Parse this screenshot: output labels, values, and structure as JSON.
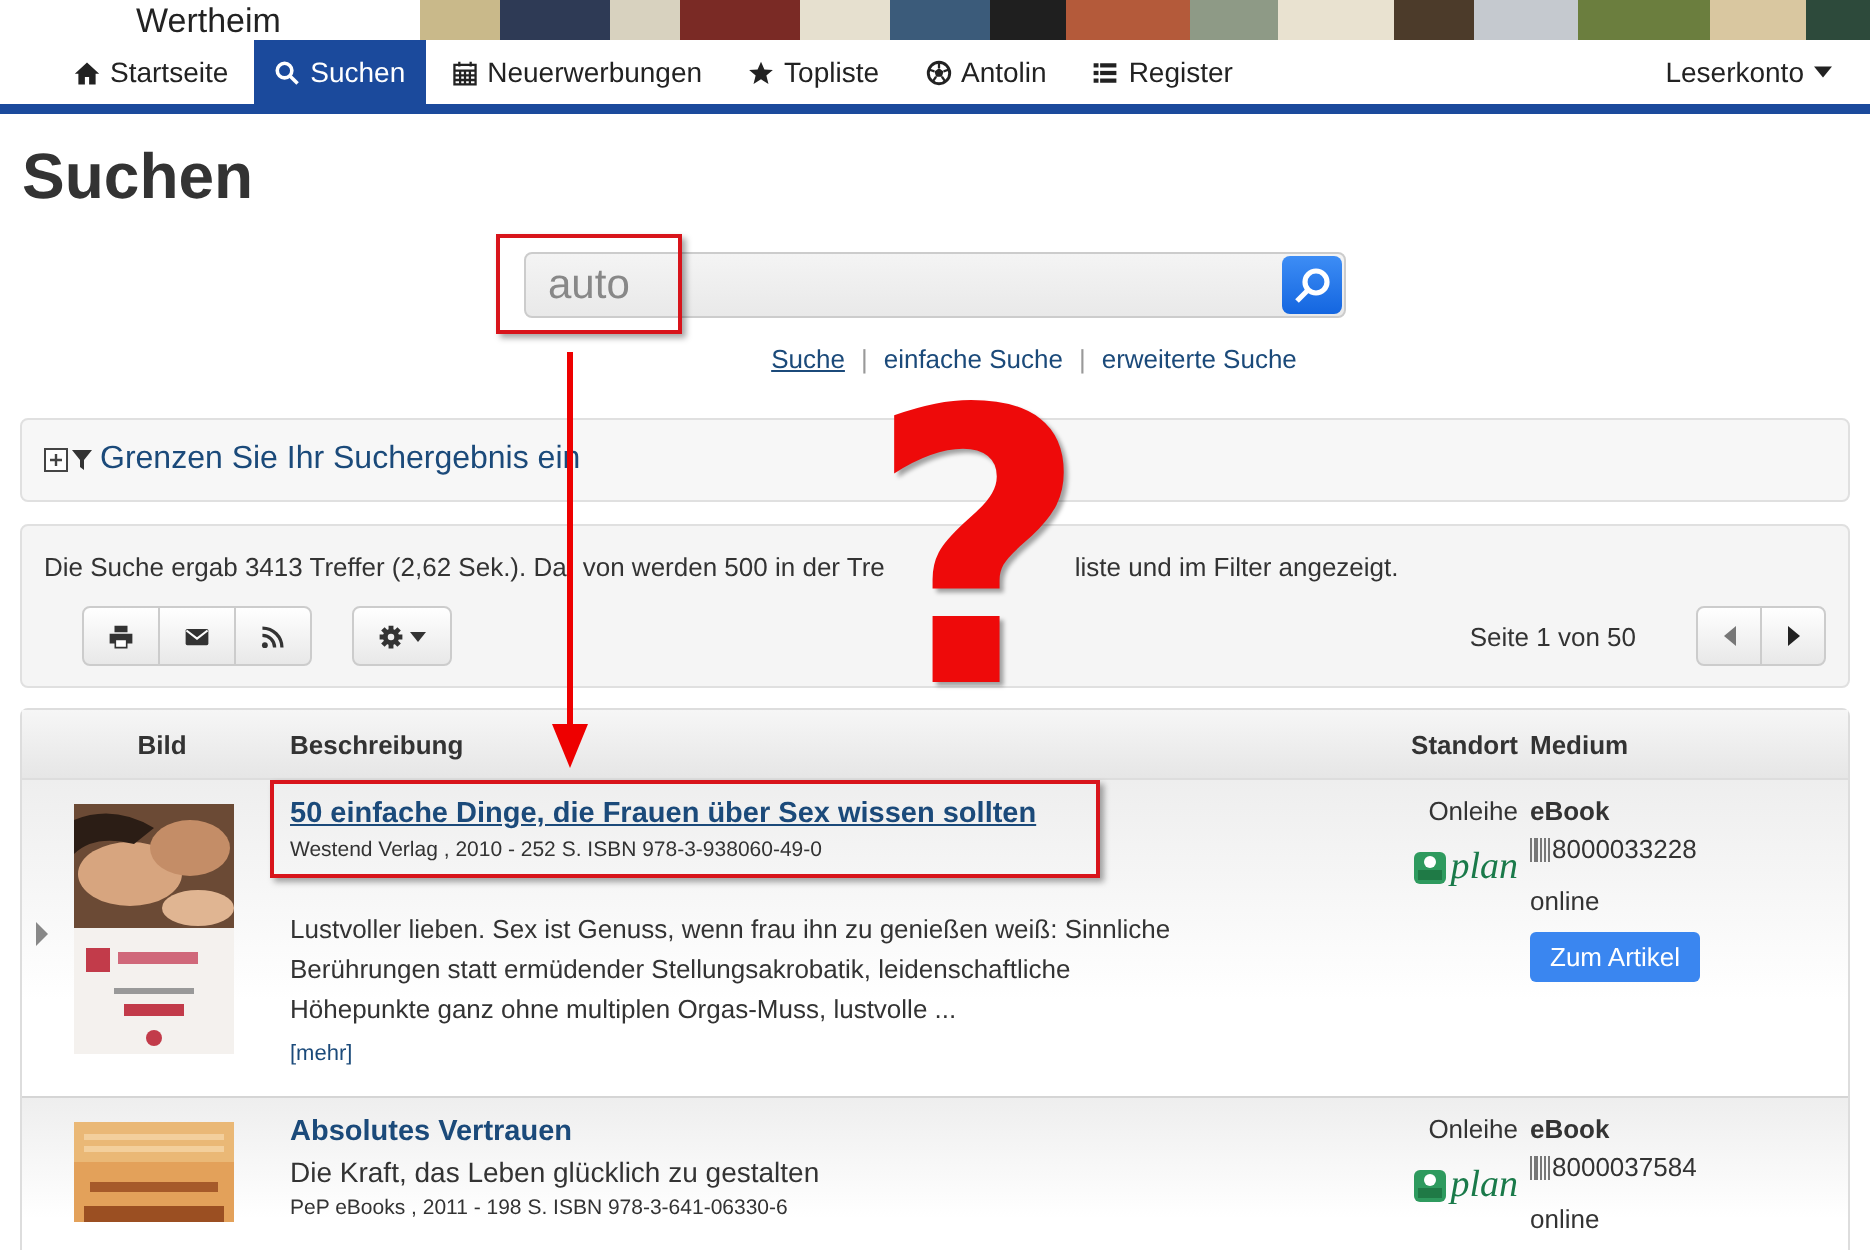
{
  "header": {
    "library_name": "Wertheim"
  },
  "nav": {
    "items": [
      {
        "label": "Startseite",
        "selected": false
      },
      {
        "label": "Suchen",
        "selected": true
      },
      {
        "label": "Neuerwerbungen",
        "selected": false
      },
      {
        "label": "Topliste",
        "selected": false
      },
      {
        "label": "Antolin",
        "selected": false
      },
      {
        "label": "Register",
        "selected": false
      }
    ],
    "account": "Leserkonto"
  },
  "page_title": "Suchen",
  "search": {
    "value": "auto",
    "highlighted": true,
    "separator": "|",
    "links": [
      {
        "label": "Suche",
        "selected": true
      },
      {
        "label": "einfache Suche",
        "selected": false
      },
      {
        "label": "erweiterte Suche",
        "selected": false
      }
    ]
  },
  "filter_panel": {
    "label": "Grenzen Sie Ihr Suchergebnis ein",
    "expanded": false
  },
  "results": {
    "summary_parts": [
      "Die Suche ergab 3413 Treffer (2,62 Sek.). Da",
      "von werden 500 in der Tre",
      "liste und im Filter angezeigt."
    ],
    "page_info": "Seite 1 von 50"
  },
  "table": {
    "columns": [
      "Bild",
      "Beschreibung",
      "Standort",
      "Medium"
    ],
    "rows": [
      {
        "expander": true,
        "highlighted": true,
        "title": "50 einfache Dinge, die Frauen über Sex wissen sollten",
        "publisher": "Westend Verlag , 2010 - 252 S. ISBN 978-3-938060-49-0",
        "description": "Lustvoller lieben. Sex ist Genuss, wenn frau ihn zu genießen weiß: Sinnliche Berührungen statt ermüdender Stellungsakrobatik, leidenschaftliche Höhepunkte ganz ohne multiplen Orgas-Muss, lustvolle ...",
        "more": "[mehr]",
        "location": "Onleihe",
        "location_logo": "plan",
        "medium": "eBook",
        "barcode": "8000033228",
        "availability": "online",
        "button": "Zum Artikel"
      },
      {
        "expander": false,
        "highlighted": false,
        "title": "Absolutes Vertrauen",
        "subtitle": "Die Kraft, das Leben glücklich zu gestalten",
        "publisher": "PeP eBooks , 2011 - 198 S. ISBN 978-3-641-06330-6",
        "location": "Onleihe",
        "location_logo": "plan",
        "medium": "eBook",
        "barcode": "8000037584",
        "availability": "online"
      }
    ]
  },
  "annotation": {
    "arrow": true,
    "mark": "?"
  }
}
